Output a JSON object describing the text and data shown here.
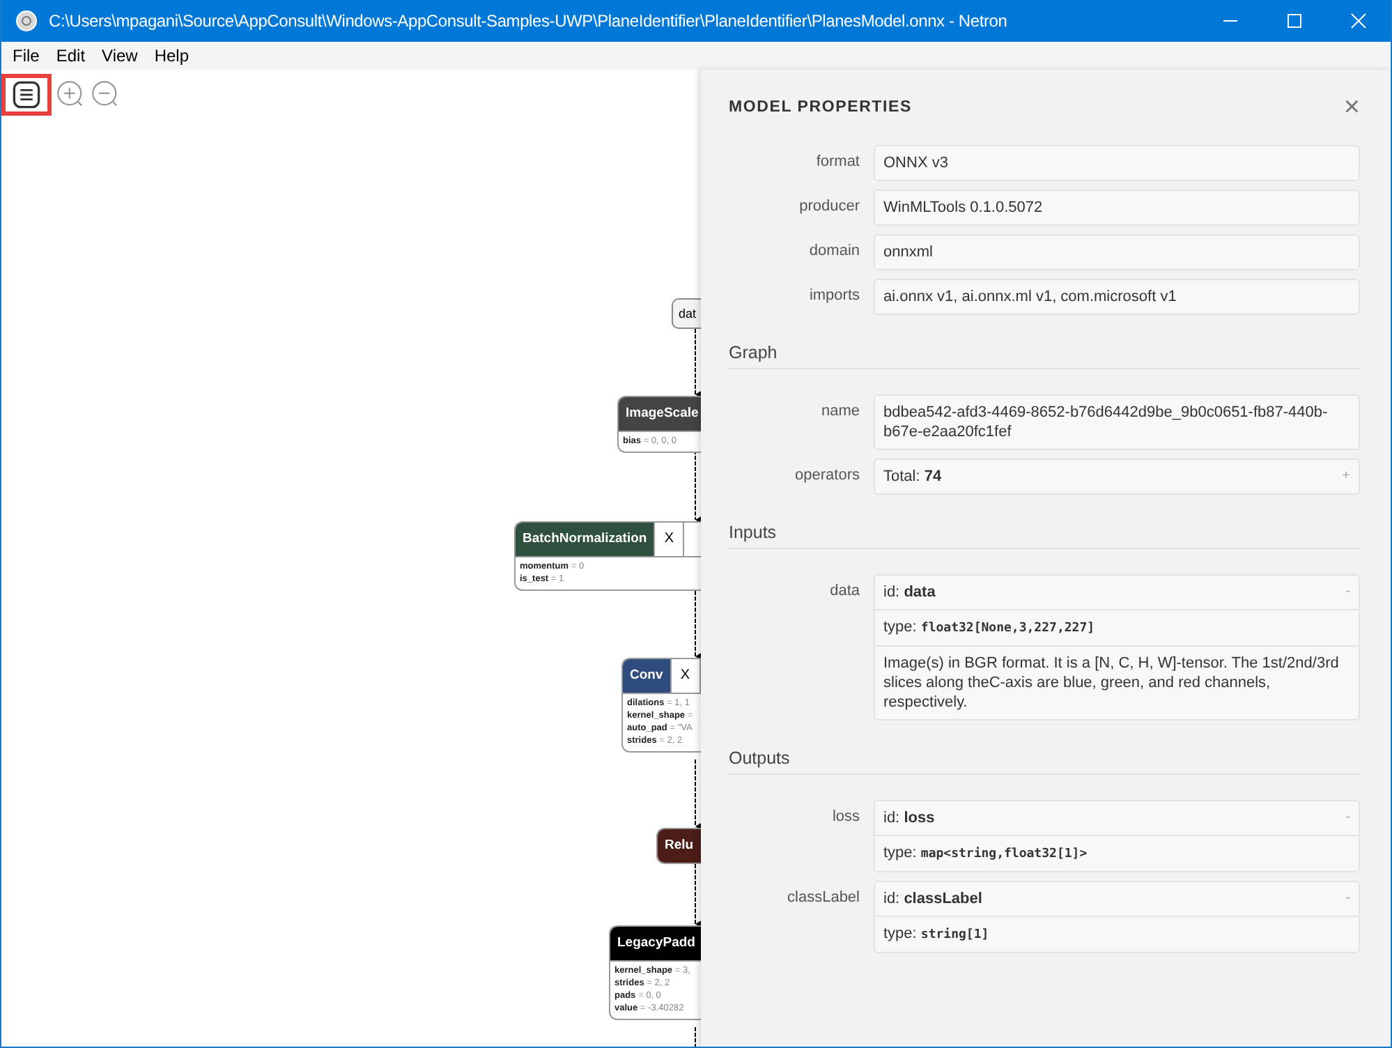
{
  "window": {
    "title": "C:\\Users\\mpagani\\Source\\AppConsult\\Windows-AppConsult-Samples-UWP\\PlaneIdentifier\\PlaneIdentifier\\PlanesModel.onnx - Netron"
  },
  "menu": [
    "File",
    "Edit",
    "View",
    "Help"
  ],
  "graph": {
    "nodes": [
      {
        "kind": "input",
        "name": "dat"
      },
      {
        "kind": "op",
        "name": "ImageScale",
        "color": "#444444",
        "attributes": [
          "**bias** = 0, 0, 0"
        ]
      },
      {
        "kind": "op",
        "name": "BatchNormalization",
        "color": "#2f4f3f",
        "tab": "X",
        "attributes": [
          "**momentum** = 0",
          "**is_test** = 1"
        ]
      },
      {
        "kind": "op",
        "name": "Conv",
        "color": "#2e4c7e",
        "tab": "X",
        "attributes": [
          "**dilations** = 1, 1",
          "**kernel_shape** =",
          "**auto_pad** = \"VA",
          "**strides** = 2, 2"
        ]
      },
      {
        "kind": "op",
        "name": "Relu",
        "color": "#4b1d16"
      },
      {
        "kind": "op",
        "name": "LegacyPadd",
        "color": "#000000",
        "attributes": [
          "**kernel_shape** = 3,",
          "**strides** = 2, 2",
          "**pads** = 0, 0",
          "**value** = -3.40282"
        ]
      }
    ]
  },
  "properties": {
    "title": "MODEL PROPERTIES",
    "close": "×",
    "model": [
      {
        "label": "format",
        "value": "ONNX v3"
      },
      {
        "label": "producer",
        "value": "WinMLTools 0.1.0.5072"
      },
      {
        "label": "domain",
        "value": "onnxml"
      },
      {
        "label": "imports",
        "value": "ai.onnx v1, ai.onnx.ml v1, com.microsoft v1"
      }
    ],
    "graph": {
      "heading": "Graph",
      "rows": [
        {
          "label": "name",
          "value": "bdbea542-afd3-4469-8652-b76d6442d9be_9b0c0651-fb87-440b-b67e-e2aa20fc1fef"
        },
        {
          "label": "operators",
          "value": "Total: **74**",
          "toggle": "+"
        }
      ]
    },
    "sections": [
      {
        "heading": "Inputs",
        "args": [
          {
            "label": "data",
            "id_prefix": "id:",
            "id": "data",
            "type_prefix": "type:",
            "type": "float32[None,3,227,227]",
            "description": "Image(s) in BGR format. It is a [N, C, H, W]-tensor. The 1st/2nd/3rd slices along theC-axis are blue, green, and red channels, respectively.",
            "toggle": "-"
          }
        ]
      },
      {
        "heading": "Outputs",
        "args": [
          {
            "label": "loss",
            "id_prefix": "id:",
            "id": "loss",
            "type_prefix": "type:",
            "type": "map<string,float32[1]>",
            "toggle": "-"
          },
          {
            "label": "classLabel",
            "id_prefix": "id:",
            "id": "classLabel",
            "type_prefix": "type:",
            "type": "string[1]",
            "toggle": "-"
          }
        ]
      }
    ]
  }
}
